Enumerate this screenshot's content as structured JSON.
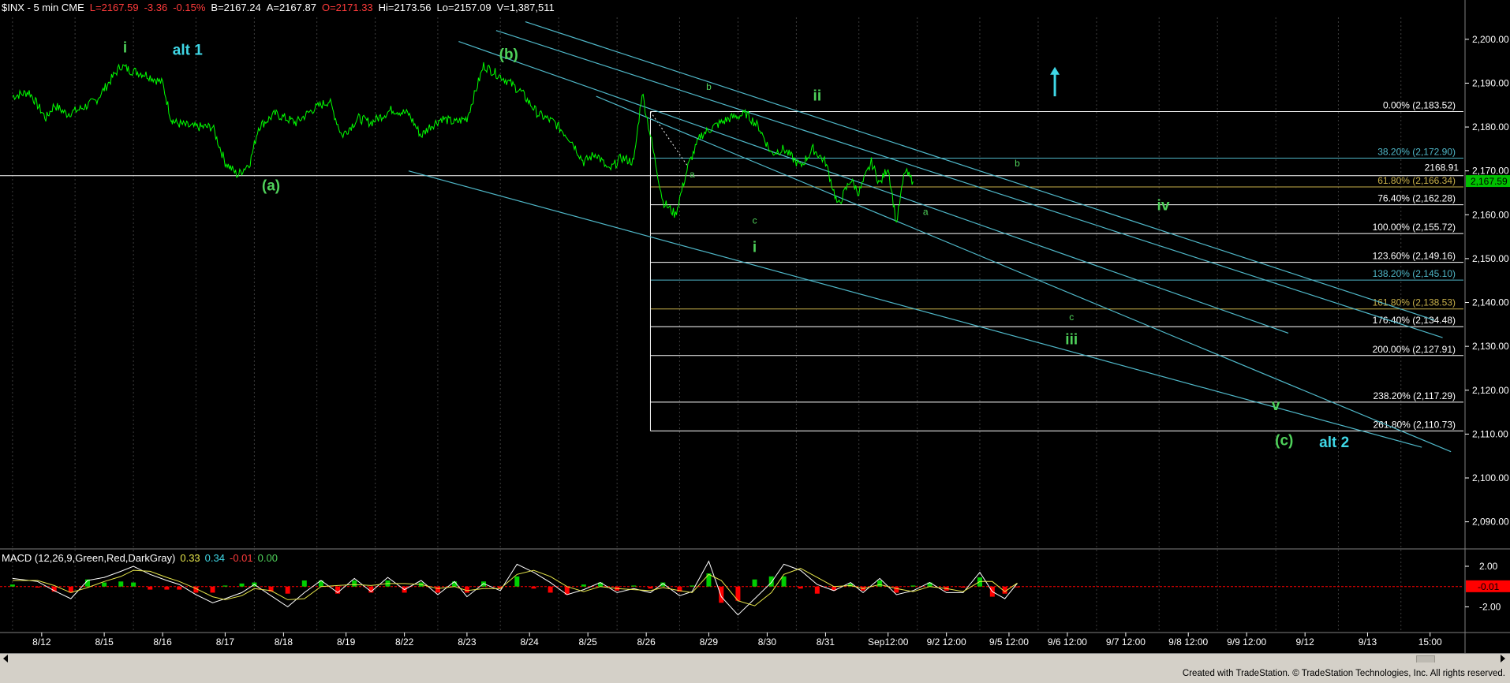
{
  "header": {
    "symbol": "$INX - 5 min  CME",
    "last": "L=2167.59",
    "change": "-3.36",
    "pct": "-0.15%",
    "bid": "B=2167.24",
    "ask": "A=2167.87",
    "open": "O=2171.33",
    "high": "Hi=2173.56",
    "low": "Lo=2157.09",
    "volume": "V=1,387,511"
  },
  "colors": {
    "background": "#000000",
    "price": "#00ff00",
    "fib": "#ffffff",
    "channel": "#4fb7c8",
    "wave_green": "#4fd15a",
    "wave_cyan": "#3fd7e6",
    "macd_pos": "#00d000",
    "macd_neg": "#ff0000",
    "axis_text": "#ffffff",
    "footer": "#d4d0c8"
  },
  "chart_data": {
    "type": "line",
    "title": "$INX - 5 min",
    "y_range": [
      2084,
      2205
    ],
    "y_ticks": [
      "2,200.00",
      "2,190.00",
      "2,180.00",
      "2,170.00",
      "2,160.00",
      "2,150.00",
      "2,140.00",
      "2,130.00",
      "2,120.00",
      "2,110.00",
      "2,100.00",
      "2,090.00"
    ],
    "y_tick_values": [
      2200,
      2190,
      2180,
      2170,
      2160,
      2150,
      2140,
      2130,
      2120,
      2110,
      2100,
      2090
    ],
    "x_labels": [
      "8/12",
      "8/15",
      "8/16",
      "8/17",
      "8/18",
      "8/19",
      "8/22",
      "8/23",
      "8/24",
      "8/25",
      "8/26",
      "8/29",
      "8/30",
      "8/31",
      "Sep12:00",
      "9/2 12:00",
      "9/5 12:00",
      "9/6 12:00",
      "9/7 12:00",
      "9/8 12:00",
      "9/9 12:00",
      "9/12",
      "9/13",
      "15:00"
    ],
    "session_index": [
      0.7,
      2.2,
      3.6,
      5.1,
      6.5,
      8.0,
      9.4,
      10.9,
      12.4,
      13.8,
      15.2,
      16.7,
      18.1,
      19.5,
      21.0,
      22.4,
      23.9,
      25.3,
      26.7,
      28.2,
      29.6,
      31.0,
      32.5,
      34.0
    ],
    "price_series": {
      "name": "$INX",
      "x": [
        0,
        0.4,
        0.8,
        1.0,
        1.3,
        1.6,
        2.0,
        2.3,
        2.6,
        2.8,
        3.2,
        3.6,
        3.8,
        3.9,
        4.3,
        4.8,
        5.1,
        5.4,
        5.7,
        5.9,
        6.3,
        6.8,
        7.2,
        7.6,
        7.9,
        8.3,
        8.6,
        9.1,
        9.5,
        9.8,
        10.0,
        10.3,
        10.6,
        10.9,
        11.3,
        11.8,
        12.2,
        12.6,
        13.0,
        13.4,
        13.7,
        14.0,
        14.3,
        14.6,
        14.9,
        15.1,
        15.3,
        15.6,
        15.9,
        16.2,
        16.5,
        16.8,
        17.2,
        17.6,
        17.9,
        18.2,
        18.5,
        18.9,
        19.2,
        19.5,
        19.8,
        20.1,
        20.3,
        20.6,
        20.8,
        21.0,
        21.2,
        21.4,
        21.6
      ],
      "y": [
        2187,
        2188,
        2182,
        2185,
        2183,
        2184,
        2186,
        2190,
        2194,
        2193,
        2192,
        2190,
        2182,
        2181,
        2180,
        2180,
        2172,
        2169,
        2172,
        2180,
        2183,
        2181,
        2184,
        2186,
        2178,
        2182,
        2181,
        2184,
        2183,
        2178,
        2180,
        2182,
        2181,
        2182,
        2194,
        2191,
        2188,
        2183,
        2181,
        2177,
        2172,
        2174,
        2170,
        2173,
        2172,
        2188,
        2178,
        2163,
        2160,
        2171,
        2178,
        2180,
        2182,
        2183,
        2180,
        2174,
        2175,
        2171,
        2175,
        2172,
        2162,
        2168,
        2165,
        2172,
        2167,
        2171,
        2158,
        2170,
        2167.59
      ]
    },
    "fib_levels": [
      {
        "pct": "0.00%",
        "value": 2183.52,
        "label": "0.00% (2,183.52)",
        "color": "#ffffff"
      },
      {
        "pct": "38.20%",
        "value": 2172.9,
        "label": "38.20% (2,172.90)",
        "color": "#4fb7c8"
      },
      {
        "pct": "61.80%",
        "value": 2166.34,
        "label": "61.80% (2,166.34)",
        "color": "#c8b04a"
      },
      {
        "pct": "76.40%",
        "value": 2162.28,
        "label": "76.40% (2,162.28)",
        "color": "#ffffff"
      },
      {
        "pct": "100.00%",
        "value": 2155.72,
        "label": "100.00% (2,155.72)",
        "color": "#ffffff"
      },
      {
        "pct": "123.60%",
        "value": 2149.16,
        "label": "123.60% (2,149.16)",
        "color": "#ffffff"
      },
      {
        "pct": "138.20%",
        "value": 2145.1,
        "label": "138.20% (2,145.10)",
        "color": "#4fb7c8"
      },
      {
        "pct": "161.80%",
        "value": 2138.53,
        "label": "161.80% (2,138.53)",
        "color": "#c8b04a"
      },
      {
        "pct": "176.40%",
        "value": 2134.48,
        "label": "176.40% (2,134.48)",
        "color": "#ffffff"
      },
      {
        "pct": "200.00%",
        "value": 2127.91,
        "label": "200.00% (2,127.91)",
        "color": "#ffffff"
      },
      {
        "pct": "238.20%",
        "value": 2117.29,
        "label": "238.20% (2,117.29)",
        "color": "#ffffff"
      },
      {
        "pct": "261.80%",
        "value": 2110.73,
        "label": "261.80% (2,110.73)",
        "color": "#ffffff"
      }
    ],
    "horizontal_line": {
      "value": 2168.91,
      "label": "2168.91"
    },
    "last_price_label": "2,167.59",
    "channel_lines": [
      {
        "x": [
          10.7,
          30.6
        ],
        "y": [
          2199.5,
          2133
        ]
      },
      {
        "x": [
          11.6,
          34.3
        ],
        "y": [
          2202,
          2132
        ]
      },
      {
        "x": [
          12.3,
          34.1
        ],
        "y": [
          2204,
          2136
        ]
      },
      {
        "x": [
          9.5,
          33.8
        ],
        "y": [
          2170,
          2107
        ]
      },
      {
        "x": [
          14.0,
          34.5
        ],
        "y": [
          2187,
          2106
        ]
      }
    ],
    "wave_labels": [
      {
        "text": "i",
        "x": 2.7,
        "y": 2197,
        "color": "#4fd15a",
        "size": "large"
      },
      {
        "text": "alt 1",
        "x": 4.2,
        "y": 2196.5,
        "color": "#3fd7e6",
        "size": "large"
      },
      {
        "text": "(a)",
        "x": 6.2,
        "y": 2165.5,
        "color": "#4fd15a",
        "size": "large"
      },
      {
        "text": "(b)",
        "x": 11.9,
        "y": 2195.5,
        "color": "#4fd15a",
        "size": "large"
      },
      {
        "text": "a",
        "x": 16.3,
        "y": 2168.5,
        "color": "#4fd15a",
        "size": "small"
      },
      {
        "text": "b",
        "x": 16.7,
        "y": 2188.5,
        "color": "#4fd15a",
        "size": "small"
      },
      {
        "text": "c",
        "x": 17.8,
        "y": 2158,
        "color": "#4fd15a",
        "size": "small"
      },
      {
        "text": "i",
        "x": 17.8,
        "y": 2151.5,
        "color": "#4fd15a",
        "size": "large"
      },
      {
        "text": "ii",
        "x": 19.3,
        "y": 2186,
        "color": "#4fd15a",
        "size": "large"
      },
      {
        "text": "a",
        "x": 21.9,
        "y": 2160,
        "color": "#4fd15a",
        "size": "small"
      },
      {
        "text": "b",
        "x": 24.1,
        "y": 2171,
        "color": "#4fd15a",
        "size": "small"
      },
      {
        "text": "iv",
        "x": 27.6,
        "y": 2161,
        "color": "#4fd15a",
        "size": "large"
      },
      {
        "text": "c",
        "x": 25.4,
        "y": 2136,
        "color": "#4fd15a",
        "size": "small"
      },
      {
        "text": "iii",
        "x": 25.4,
        "y": 2130.5,
        "color": "#4fd15a",
        "size": "large"
      },
      {
        "text": "v",
        "x": 30.3,
        "y": 2115.5,
        "color": "#4fd15a",
        "size": "large"
      },
      {
        "text": "(c)",
        "x": 30.5,
        "y": 2107.5,
        "color": "#4fd15a",
        "size": "large"
      },
      {
        "text": "alt 2",
        "x": 31.7,
        "y": 2107,
        "color": "#3fd7e6",
        "size": "large"
      }
    ],
    "up_arrow": {
      "x": 25.0,
      "y_from": 2187,
      "y_to": 2193
    },
    "macd": {
      "label": "MACD (12,26,9,Green,Red,DarkGray)",
      "macd_value": "0.33",
      "signal_value": "0.34",
      "hist_value": "-0.01",
      "zero_value": "0.00",
      "y_ticks": [
        "2.00",
        "-2.00"
      ],
      "y_tick_values": [
        2,
        -2
      ],
      "last_label": "-0.01",
      "y_range": [
        -3.6,
        3.4
      ],
      "x": [
        0,
        0.6,
        1.0,
        1.4,
        1.8,
        2.2,
        2.6,
        2.9,
        3.3,
        3.7,
        4.0,
        4.4,
        4.8,
        5.1,
        5.5,
        5.8,
        6.2,
        6.6,
        7.0,
        7.4,
        7.8,
        8.2,
        8.6,
        9.0,
        9.4,
        9.8,
        10.2,
        10.6,
        10.9,
        11.3,
        11.7,
        12.1,
        12.5,
        12.9,
        13.3,
        13.7,
        14.1,
        14.5,
        14.9,
        15.3,
        15.6,
        16.0,
        16.3,
        16.7,
        17.0,
        17.4,
        17.8,
        18.2,
        18.5,
        18.9,
        19.3,
        19.7,
        20.1,
        20.4,
        20.8,
        21.2,
        21.6,
        22.0,
        22.4,
        22.8,
        23.2,
        23.5,
        23.8,
        24.1
      ],
      "line": [
        0.8,
        0.5,
        -0.4,
        -1.2,
        0.6,
        0.9,
        1.5,
        2.0,
        1.2,
        0.6,
        0.2,
        -0.8,
        -1.6,
        -1.2,
        -0.6,
        0.2,
        -0.9,
        -2.0,
        -0.6,
        0.6,
        -0.6,
        0.8,
        -0.5,
        0.9,
        -0.3,
        0.6,
        -0.8,
        0.5,
        -1.0,
        0.3,
        -0.4,
        2.2,
        1.4,
        0.4,
        -0.8,
        -0.3,
        0.4,
        -0.6,
        -0.2,
        -0.6,
        0.3,
        -0.9,
        -0.5,
        2.5,
        -1.0,
        -2.8,
        -1.2,
        0.4,
        2.2,
        1.6,
        0.2,
        -0.4,
        0.4,
        -0.6,
        0.8,
        -0.8,
        -0.4,
        0.4,
        -0.6,
        -0.6,
        1.4,
        -0.5,
        -1.2,
        0.33
      ],
      "signal": [
        0.6,
        0.6,
        0.1,
        -0.6,
        -0.1,
        0.5,
        1.0,
        1.6,
        1.5,
        0.9,
        0.5,
        -0.2,
        -1.0,
        -1.3,
        -0.9,
        -0.2,
        -0.4,
        -1.3,
        -1.2,
        0.0,
        0.1,
        0.2,
        0.1,
        0.3,
        0.3,
        0.2,
        -0.2,
        0.0,
        -0.4,
        -0.2,
        -0.2,
        1.2,
        1.6,
        1.0,
        0.0,
        -0.5,
        0.0,
        -0.2,
        -0.3,
        -0.4,
        -0.1,
        -0.4,
        -0.6,
        1.2,
        0.6,
        -1.4,
        -1.9,
        -0.6,
        1.2,
        1.8,
        0.9,
        0.0,
        0.1,
        -0.2,
        0.2,
        -0.2,
        -0.5,
        0.0,
        -0.2,
        -0.5,
        0.5,
        0.5,
        -0.5,
        0.34
      ]
    }
  },
  "credit": "Created with TradeStation. © TradeStation Technologies, Inc. All rights reserved."
}
